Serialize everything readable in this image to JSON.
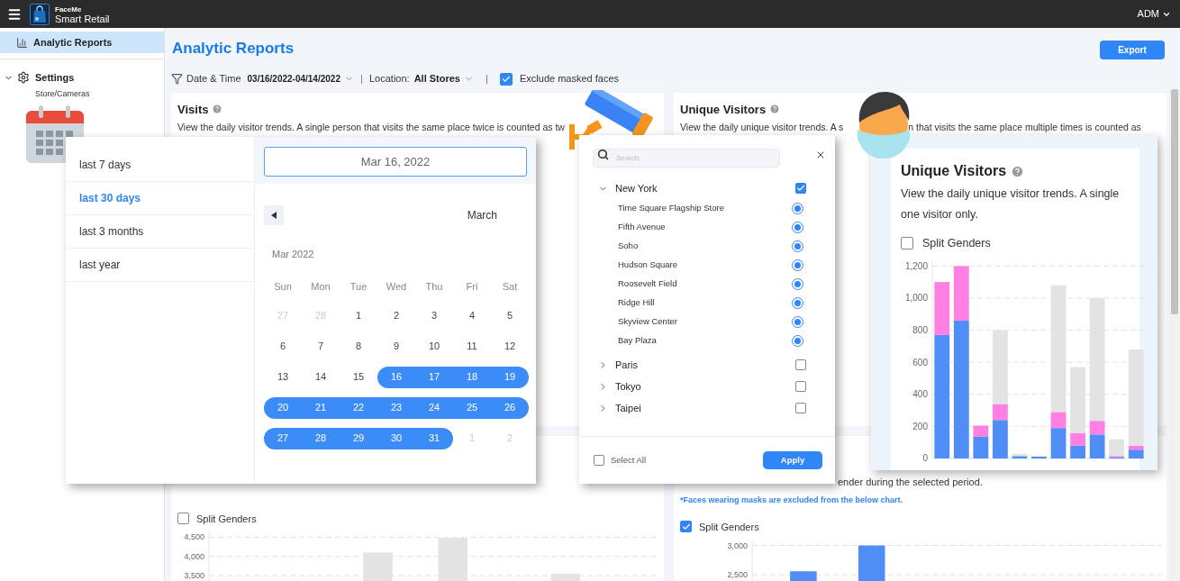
{
  "header": {
    "brand_top": "FaceMe",
    "brand": "Smart Retail",
    "user": "ADM"
  },
  "sidebar": {
    "items": [
      {
        "label": "Analytic Reports",
        "kind": "report",
        "selected": true
      },
      {
        "label": "Settings",
        "kind": "settings",
        "selected": false,
        "expanded": true,
        "children": [
          {
            "label": "Store/Cameras",
            "selected": false
          }
        ]
      }
    ]
  },
  "page": {
    "title": "Analytic Reports",
    "export_button": "Export"
  },
  "filters": {
    "date_label": "Date & Time",
    "date_value": "03/16/2022-04/14/2022",
    "location_label": "Location:",
    "location_value": "All Stores",
    "exclude": {
      "label": "Exclude masked faces",
      "checked": true
    }
  },
  "cards": [
    {
      "title": "Visits",
      "description_parts": [
        "View the daily visitor trends. A single person that visits the same place twice is counted as tw"
      ]
    },
    {
      "title": "Unique Visitors",
      "description_parts": [
        "View the daily unique visitor trends. A s",
        "n that visits the same place multiple times is counted as"
      ]
    }
  ],
  "bottom_cards": [
    {
      "split_genders": {
        "label": "Split Genders",
        "checked": false
      },
      "chart_data": {
        "type": "bar",
        "grid": true,
        "ylim": [
          3150,
          4650
        ],
        "yticks": [
          {
            "value": 3500,
            "label": "3,500"
          },
          {
            "value": 4000,
            "label": "4,000"
          },
          {
            "value": 4500,
            "label": "4,500"
          }
        ],
        "series": [
          {
            "color": "#e3e3e3",
            "values": [
              null,
              null,
              null,
              null,
              4100,
              null,
              4480,
              null,
              null,
              3550,
              null,
              null
            ]
          }
        ]
      }
    },
    {
      "description": "ender during the selected period.",
      "note": "*Faces wearing masks are excluded from the below chart.",
      "split_genders": {
        "label": "Split Genders",
        "checked": true
      },
      "chart_data": {
        "type": "bar",
        "grid": true,
        "ylim": [
          2120,
          3100
        ],
        "yticks": [
          {
            "value": 2500,
            "label": "2,500"
          },
          {
            "value": 3000,
            "label": "3,000"
          }
        ],
        "series": [
          {
            "color": "#4f8ef7",
            "values": [
              null,
              2560,
              null,
              3000,
              null,
              null,
              null,
              null,
              null,
              null,
              null,
              null
            ]
          }
        ]
      }
    }
  ],
  "date_picker": {
    "presets": [
      {
        "label": "last 7 days",
        "selected": false
      },
      {
        "label": "last 30 days",
        "selected": true
      },
      {
        "label": "last 3 months",
        "selected": false
      },
      {
        "label": "last year",
        "selected": false
      }
    ],
    "input_value": "Mar 16, 2022",
    "month_select": "March",
    "month_label": "Mar 2022",
    "weekdays": [
      "Sun",
      "Mon",
      "Tue",
      "Wed",
      "Thu",
      "Fri",
      "Sat"
    ],
    "weeks": [
      [
        {
          "day": "27",
          "muted": true,
          "selected": false
        },
        {
          "day": "28",
          "muted": true,
          "selected": false
        },
        {
          "day": "1",
          "muted": false,
          "selected": false
        },
        {
          "day": "2",
          "muted": false,
          "selected": false
        },
        {
          "day": "3",
          "muted": false,
          "selected": false
        },
        {
          "day": "4",
          "muted": false,
          "selected": false
        },
        {
          "day": "5",
          "muted": false,
          "selected": false
        }
      ],
      [
        {
          "day": "6",
          "muted": false,
          "selected": false
        },
        {
          "day": "7",
          "muted": false,
          "selected": false
        },
        {
          "day": "8",
          "muted": false,
          "selected": false
        },
        {
          "day": "9",
          "muted": false,
          "selected": false
        },
        {
          "day": "10",
          "muted": false,
          "selected": false
        },
        {
          "day": "11",
          "muted": false,
          "selected": false
        },
        {
          "day": "12",
          "muted": false,
          "selected": false
        }
      ],
      [
        {
          "day": "13",
          "muted": false,
          "selected": false
        },
        {
          "day": "14",
          "muted": false,
          "selected": false
        },
        {
          "day": "15",
          "muted": false,
          "selected": false
        },
        {
          "day": "16",
          "muted": false,
          "selected": true
        },
        {
          "day": "17",
          "muted": false,
          "selected": true
        },
        {
          "day": "18",
          "muted": false,
          "selected": true
        },
        {
          "day": "19",
          "muted": false,
          "selected": true
        }
      ],
      [
        {
          "day": "20",
          "muted": false,
          "selected": true
        },
        {
          "day": "21",
          "muted": false,
          "selected": true
        },
        {
          "day": "22",
          "muted": false,
          "selected": true
        },
        {
          "day": "23",
          "muted": false,
          "selected": true
        },
        {
          "day": "24",
          "muted": false,
          "selected": true
        },
        {
          "day": "25",
          "muted": false,
          "selected": true
        },
        {
          "day": "26",
          "muted": false,
          "selected": true
        }
      ],
      [
        {
          "day": "27",
          "muted": false,
          "selected": true
        },
        {
          "day": "28",
          "muted": false,
          "selected": true
        },
        {
          "day": "29",
          "muted": false,
          "selected": true
        },
        {
          "day": "30",
          "muted": false,
          "selected": true
        },
        {
          "day": "31",
          "muted": false,
          "selected": true
        },
        {
          "day": "1",
          "muted": true,
          "selected": false
        },
        {
          "day": "2",
          "muted": true,
          "selected": false
        }
      ]
    ]
  },
  "location_picker": {
    "search_placeholder": "Search",
    "groups": [
      {
        "name": "New York",
        "expanded": true,
        "checked": true,
        "stores": [
          {
            "name": "Time Square Flagship Store",
            "selected": true
          },
          {
            "name": "Fifth Avenue",
            "selected": true
          },
          {
            "name": "Soho",
            "selected": true
          },
          {
            "name": "Hudson Square",
            "selected": true
          },
          {
            "name": "Roosevelt Field",
            "selected": true
          },
          {
            "name": "Ridge Hill",
            "selected": true
          },
          {
            "name": "Skyview Center",
            "selected": true
          },
          {
            "name": "Bay Plaza",
            "selected": true
          }
        ]
      },
      {
        "name": "Paris",
        "expanded": false,
        "checked": false
      },
      {
        "name": "Tokyo",
        "expanded": false,
        "checked": false
      },
      {
        "name": "Taipei",
        "expanded": false,
        "checked": false
      }
    ],
    "select_all": {
      "label": "Select All",
      "checked": false
    },
    "apply": "Apply"
  },
  "zoom_card": {
    "title": "Unique Visitors",
    "description_lines": [
      "View the daily unique visitor trends. A single",
      "one visitor only."
    ],
    "split_genders": {
      "label": "Split Genders",
      "checked": false
    },
    "chart_data": {
      "type": "bar",
      "stacked": true,
      "grid": true,
      "ylim": [
        0,
        1230
      ],
      "yticks": [
        {
          "value": 0,
          "label": "0"
        },
        {
          "value": 200,
          "label": "200"
        },
        {
          "value": 400,
          "label": "400"
        },
        {
          "value": 600,
          "label": "600"
        },
        {
          "value": 800,
          "label": "800"
        },
        {
          "value": 1000,
          "label": "1,000"
        },
        {
          "value": 1200,
          "label": "1,200"
        }
      ],
      "series": [
        {
          "color": "#4f8ef7",
          "values": [
            770,
            860,
            135,
            240,
            15,
            12,
            190,
            80,
            150,
            8,
            55
          ]
        },
        {
          "color": "#ff80e2",
          "values": [
            330,
            340,
            70,
            100,
            0,
            0,
            100,
            80,
            85,
            8,
            25
          ]
        },
        {
          "color": "#e3e3e3",
          "values": [
            0,
            0,
            0,
            460,
            15,
            null,
            790,
            410,
            765,
            104,
            600
          ]
        }
      ]
    }
  }
}
